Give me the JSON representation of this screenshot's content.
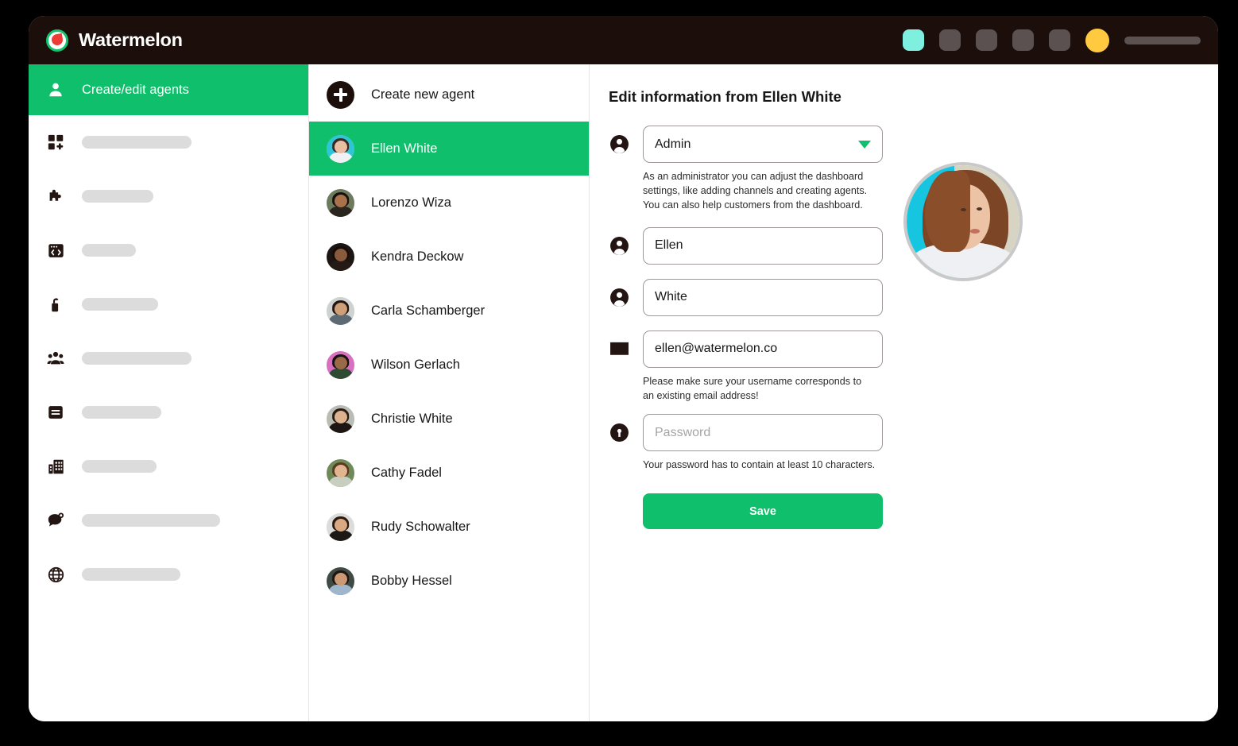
{
  "window": {
    "brand_name": "Watermelon",
    "logo_icon": "watermelon-logo-icon"
  },
  "titlebar": {
    "controls": [
      {
        "name": "chip-1",
        "shape": "rounded-square",
        "color": "#7ff0e0"
      },
      {
        "name": "chip-2",
        "shape": "rounded-square",
        "color": "#5a5150"
      },
      {
        "name": "chip-3",
        "shape": "rounded-square",
        "color": "#5a5150"
      },
      {
        "name": "chip-4",
        "shape": "rounded-square",
        "color": "#5a5150"
      },
      {
        "name": "chip-5",
        "shape": "rounded-square",
        "color": "#5a5150"
      },
      {
        "name": "status-dot",
        "shape": "circle",
        "color": "#ffc940"
      },
      {
        "name": "placeholder-bar",
        "shape": "bar",
        "color": "#5a5150"
      }
    ]
  },
  "sidebar": {
    "active_item": {
      "label": "Create/edit agents",
      "icon": "user-icon"
    },
    "items": [
      {
        "icon": "grid-plus-icon",
        "skeleton_width": 138
      },
      {
        "icon": "puzzle-icon",
        "skeleton_width": 90
      },
      {
        "icon": "code-window-icon",
        "skeleton_width": 68
      },
      {
        "icon": "lock-icon",
        "skeleton_width": 96
      },
      {
        "icon": "users-group-icon",
        "skeleton_width": 138
      },
      {
        "icon": "list-icon",
        "skeleton_width": 100
      },
      {
        "icon": "building-icon",
        "skeleton_width": 94
      },
      {
        "icon": "chat-badge-icon",
        "skeleton_width": 174
      },
      {
        "icon": "globe-icon",
        "skeleton_width": 124
      }
    ]
  },
  "agent_list": {
    "create_label": "Create new agent",
    "create_icon": "plus-circle-icon",
    "agents": [
      {
        "name": "Ellen White",
        "selected": true,
        "bg": "#2ec5d8",
        "skin": "#e8bfa3",
        "hair": "#3c2a22",
        "body": "#f0f1f5"
      },
      {
        "name": "Lorenzo Wiza",
        "selected": false,
        "bg": "#6d7a5e",
        "skin": "#a9714c",
        "hair": "#17110c",
        "body": "#2b2520"
      },
      {
        "name": "Kendra Deckow",
        "selected": false,
        "bg": "#1d1512",
        "skin": "#8a5a3c",
        "hair": "#140d0a",
        "body": "#241b16"
      },
      {
        "name": "Carla Schamberger",
        "selected": false,
        "bg": "#cfd3d0",
        "skin": "#cf9f78",
        "hair": "#241713",
        "body": "#5d6a73"
      },
      {
        "name": "Wilson Gerlach",
        "selected": false,
        "bg": "#d96fc0",
        "skin": "#9a6a48",
        "hair": "#1a1210",
        "body": "#2f4a33"
      },
      {
        "name": "Christie White",
        "selected": false,
        "bg": "#b9bdb4",
        "skin": "#ddb28f",
        "hair": "#2a1b15",
        "body": "#1d1512"
      },
      {
        "name": "Cathy Fadel",
        "selected": false,
        "bg": "#6f8a59",
        "skin": "#e2b591",
        "hair": "#5b3a22",
        "body": "#c7cfc1"
      },
      {
        "name": "Rudy Schowalter",
        "selected": false,
        "bg": "#dcdcda",
        "skin": "#d8a982",
        "hair": "#2b1a12",
        "body": "#1d1815"
      },
      {
        "name": "Bobby Hessel",
        "selected": false,
        "bg": "#3f4a44",
        "skin": "#cb9a75",
        "hair": "#20150f",
        "body": "#9fb6cc"
      }
    ]
  },
  "edit_panel": {
    "title_prefix": "Edit information from ",
    "title_name": "Ellen White",
    "role": {
      "icon": "user-circle-icon",
      "value": "Admin",
      "caret_icon": "chevron-down-icon",
      "caret_color": "#10bf6c",
      "helper": "As an administrator you can adjust the dashboard settings, like adding channels and creating agents. You can also help customers from the dashboard."
    },
    "first_name": {
      "icon": "user-circle-icon",
      "value": "Ellen"
    },
    "last_name": {
      "icon": "user-circle-icon",
      "value": "White"
    },
    "email": {
      "icon": "envelope-icon",
      "value": "ellen@watermelon.co",
      "helper": "Please make sure your username corresponds to an existing email address!"
    },
    "password": {
      "icon": "lock-icon",
      "placeholder": "Password",
      "helper": "Your password has to contain at least 10 characters."
    },
    "save_label": "Save",
    "profile_photo_alt": "agent-profile-photo"
  },
  "colors": {
    "brand_green": "#10bf6c",
    "titlebar": "#1c0f0b",
    "skeleton_gray": "#dcdcdc"
  }
}
